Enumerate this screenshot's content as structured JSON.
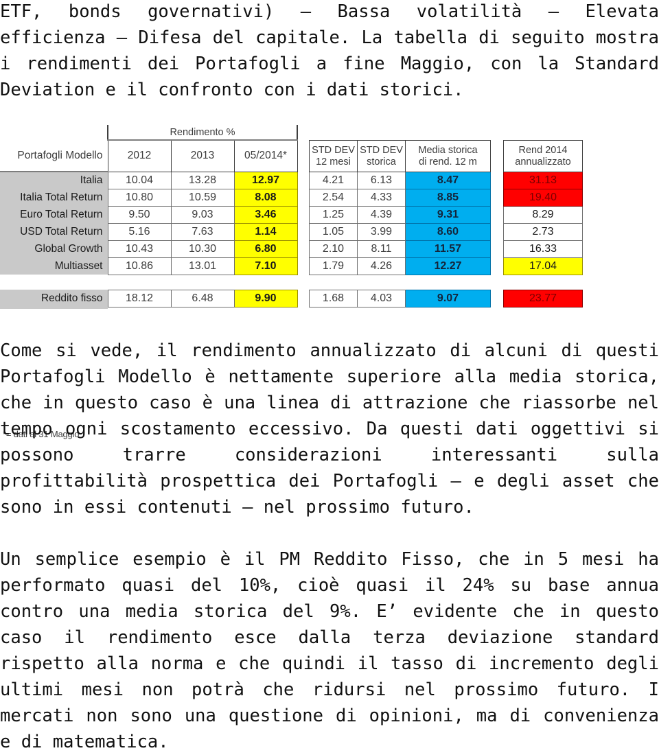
{
  "intro": {
    "paragraphs": [
      "ETF, bonds governativi) – Bassa volatilità – Elevata efficienza – Difesa del capitale. La tabella di seguito mostra i rendimenti dei Portafogli a fine Maggio, con la Standard Deviation e il confronto con i dati storici."
    ]
  },
  "table": {
    "caption_rendimento": "Rendimento %",
    "col_label_header": "Portafogli Modello",
    "columns_rendimento": [
      "2012",
      "2013",
      "05/2014*"
    ],
    "columns_std": [
      {
        "line1": "STD DEV",
        "line2": "12 mesi"
      },
      {
        "line1": "STD DEV",
        "line2": "storica"
      },
      {
        "line1": "Media storica",
        "line2": "di rend. 12 m"
      }
    ],
    "column_rend2014": {
      "line1": "Rend 2014",
      "line2": "annualizzato"
    },
    "rows": [
      {
        "label": "Italia",
        "y2012": "10.04",
        "y2013": "13.28",
        "y2014": "12.97",
        "std12": "4.21",
        "stdstorica": "6.13",
        "media": "8.47",
        "rend2014": "31.13",
        "rend_style": "hl-red"
      },
      {
        "label": "Italia Total Return",
        "y2012": "10.80",
        "y2013": "10.59",
        "y2014": "8.08",
        "std12": "2.54",
        "stdstorica": "4.33",
        "media": "8.85",
        "rend2014": "19.40",
        "rend_style": "hl-red"
      },
      {
        "label": "Euro Total Return",
        "y2012": "9.50",
        "y2013": "9.03",
        "y2014": "3.46",
        "std12": "1.25",
        "stdstorica": "4.39",
        "media": "9.31",
        "rend2014": "8.29",
        "rend_style": ""
      },
      {
        "label": "USD Total Return",
        "y2012": "5.16",
        "y2013": "7.63",
        "y2014": "1.14",
        "std12": "1.05",
        "stdstorica": "3.99",
        "media": "8.60",
        "rend2014": "2.73",
        "rend_style": ""
      },
      {
        "label": "Global Growth",
        "y2012": "10.43",
        "y2013": "10.30",
        "y2014": "6.80",
        "std12": "2.10",
        "stdstorica": "8.11",
        "media": "11.57",
        "rend2014": "16.33",
        "rend_style": ""
      },
      {
        "label": "Multiasset",
        "y2012": "10.86",
        "y2013": "13.01",
        "y2014": "7.10",
        "std12": "1.79",
        "stdstorica": "4.26",
        "media": "12.27",
        "rend2014": "17.04",
        "rend_style": "hl-yellow"
      }
    ],
    "extra_row": {
      "label": "Reddito fisso",
      "y2012": "18.12",
      "y2013": "6.48",
      "y2014": "9.90",
      "std12": "1.68",
      "stdstorica": "4.03",
      "media": "9.07",
      "rend2014": "23.77",
      "rend_style": "hl-red"
    },
    "footnote": "*= dati al 31 Maggio",
    "colors": {
      "highlight_yellow": "#ffff00",
      "highlight_cyan": "#00aeef",
      "highlight_red": "#ff0000",
      "label_gray": "#c9c9c9"
    }
  },
  "body": {
    "paragraphs": [
      "Come si vede, il rendimento annualizzato di alcuni di questi Portafogli Modello è nettamente superiore alla media storica, che in questo caso è una linea di attrazione che riassorbe nel tempo ogni scostamento eccessivo. Da questi dati oggettivi si possono trarre considerazioni interessanti sulla profittabilità prospettica dei Portafogli – e degli asset che sono in essi contenuti – nel prossimo futuro.",
      "Un semplice esempio è il PM Reddito Fisso, che in 5 mesi ha performato quasi del 10%, cioè quasi il 24% su base annua contro una media storica del 9%. E’ evidente che in questo caso il rendimento esce dalla terza deviazione standard rispetto alla norma e che quindi il tasso di incremento degli ultimi mesi non potrà che ridursi nel prossimo futuro. I mercati non sono una questione di opinioni, ma di convenienza e di matematica."
    ]
  }
}
